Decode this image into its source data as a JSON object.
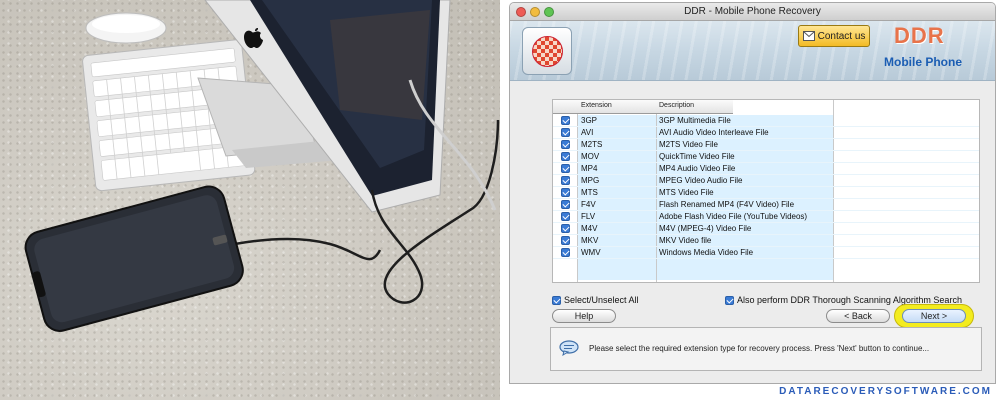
{
  "window": {
    "title": "DDR - Mobile Phone Recovery"
  },
  "banner": {
    "contact_label": "Contact us",
    "brand": "DDR",
    "subtitle": "Mobile Phone"
  },
  "table": {
    "headers": [
      "Extension",
      "Description"
    ],
    "rows": [
      {
        "ext": "3GP",
        "desc": "3GP Multimedia File",
        "checked": true
      },
      {
        "ext": "AVI",
        "desc": "AVI Audio Video Interleave File",
        "checked": true
      },
      {
        "ext": "M2TS",
        "desc": "M2TS Video File",
        "checked": true
      },
      {
        "ext": "MOV",
        "desc": "QuickTime Video File",
        "checked": true
      },
      {
        "ext": "MP4",
        "desc": "MP4 Audio Video File",
        "checked": true
      },
      {
        "ext": "MPG",
        "desc": "MPEG Video Audio File",
        "checked": true
      },
      {
        "ext": "MTS",
        "desc": "MTS Video File",
        "checked": true
      },
      {
        "ext": "F4V",
        "desc": "Flash Renamed MP4 (F4V Video) File",
        "checked": true
      },
      {
        "ext": "FLV",
        "desc": "Adobe Flash Video File (YouTube Videos)",
        "checked": true
      },
      {
        "ext": "M4V",
        "desc": "M4V (MPEG-4) Video File",
        "checked": true
      },
      {
        "ext": "MKV",
        "desc": "MKV Video file",
        "checked": true
      },
      {
        "ext": "WMV",
        "desc": "Windows Media Video File",
        "checked": true
      }
    ]
  },
  "options": {
    "select_all": "Select/Unselect All",
    "thorough_scan": "Also perform DDR Thorough Scanning Algorithm Search"
  },
  "buttons": {
    "help": "Help",
    "back": "< Back",
    "next": "Next >"
  },
  "message": "Please select the required extension type for recovery process. Press 'Next' button to continue...",
  "watermark": "DATARECOVERYSOFTWARE.COM",
  "colors": {
    "accent": "#3a7bd5",
    "brand": "#e8734a",
    "highlight": "#f3ec1f"
  }
}
